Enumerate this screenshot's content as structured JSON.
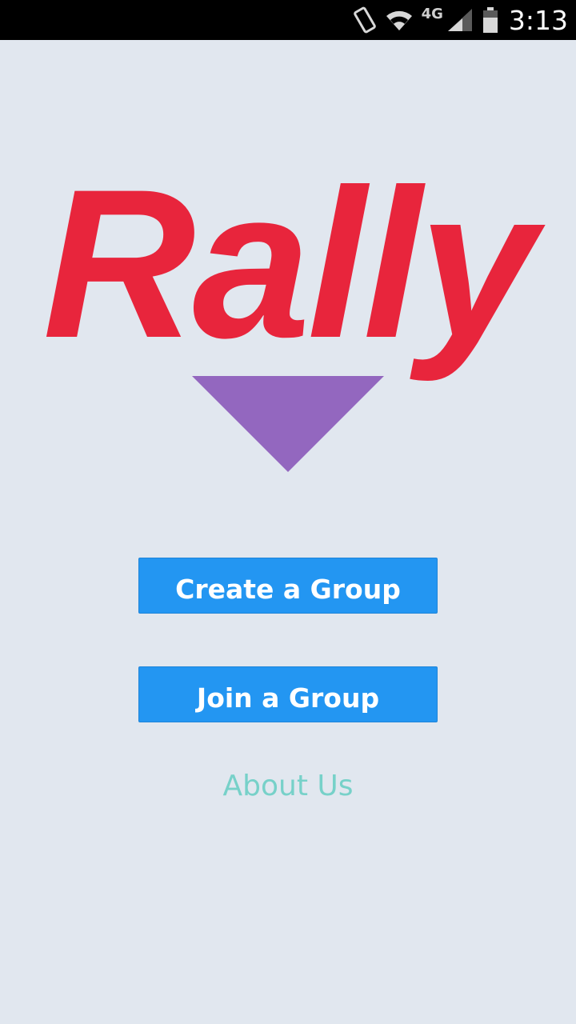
{
  "status_bar": {
    "network_type": "4G",
    "time": "3:13"
  },
  "logo": {
    "text": "Rally",
    "text_color": "#e8253c",
    "triangle_color": "#9367bf"
  },
  "buttons": {
    "create_label": "Create a Group",
    "join_label": "Join a Group",
    "color": "#2396f2"
  },
  "about": {
    "label": "About Us",
    "color": "#77d1c9"
  },
  "background_color": "#e1e7ef"
}
